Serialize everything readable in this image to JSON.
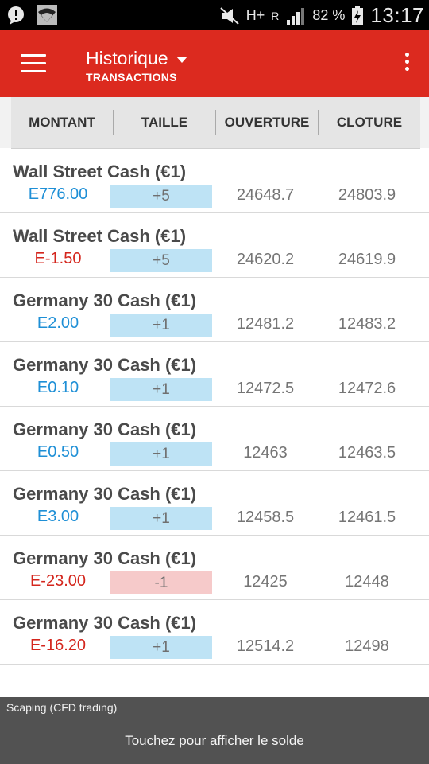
{
  "status_bar": {
    "battery_text": "82 %",
    "time": "13:17",
    "network_label": "H+",
    "roaming_label": "R"
  },
  "app_bar": {
    "title": "Historique",
    "subtitle": "TRANSACTIONS"
  },
  "columns": [
    "MONTANT",
    "TAILLE",
    "OUVERTURE",
    "CLOTURE"
  ],
  "transactions": [
    {
      "name": "Wall Street Cash (€1)",
      "amount": "E776.00",
      "amount_sign": "pos",
      "size": "+5",
      "size_sign": "pos",
      "open": "24648.7",
      "close": "24803.9"
    },
    {
      "name": "Wall Street Cash (€1)",
      "amount": "E-1.50",
      "amount_sign": "neg",
      "size": "+5",
      "size_sign": "pos",
      "open": "24620.2",
      "close": "24619.9"
    },
    {
      "name": "Germany 30 Cash (€1)",
      "amount": "E2.00",
      "amount_sign": "pos",
      "size": "+1",
      "size_sign": "pos",
      "open": "12481.2",
      "close": "12483.2"
    },
    {
      "name": "Germany 30 Cash (€1)",
      "amount": "E0.10",
      "amount_sign": "pos",
      "size": "+1",
      "size_sign": "pos",
      "open": "12472.5",
      "close": "12472.6"
    },
    {
      "name": "Germany 30 Cash (€1)",
      "amount": "E0.50",
      "amount_sign": "pos",
      "size": "+1",
      "size_sign": "pos",
      "open": "12463",
      "close": "12463.5"
    },
    {
      "name": "Germany 30 Cash (€1)",
      "amount": "E3.00",
      "amount_sign": "pos",
      "size": "+1",
      "size_sign": "pos",
      "open": "12458.5",
      "close": "12461.5"
    },
    {
      "name": "Germany 30 Cash (€1)",
      "amount": "E-23.00",
      "amount_sign": "neg",
      "size": "-1",
      "size_sign": "neg",
      "open": "12425",
      "close": "12448"
    },
    {
      "name": "Germany 30 Cash (€1)",
      "amount": "E-16.20",
      "amount_sign": "neg",
      "size": "+1",
      "size_sign": "pos",
      "open": "12514.2",
      "close": "12498"
    }
  ],
  "banner": {
    "account": "Scaping (CFD trading)",
    "action_text": "Touchez pour afficher le solde"
  },
  "colors": {
    "app_bar": "#dc2a1f",
    "positive": "#1e8fd6",
    "negative": "#d4261d",
    "positive_size_bg": "#bee3f5",
    "negative_size_bg": "#f6caca",
    "banner": "#525252"
  },
  "icons": [
    "chat-alert-icon",
    "wifi-icon",
    "mute-icon",
    "signal-icon",
    "battery-charging-icon",
    "menu-icon",
    "dropdown-caret-icon",
    "overflow-menu-icon"
  ]
}
